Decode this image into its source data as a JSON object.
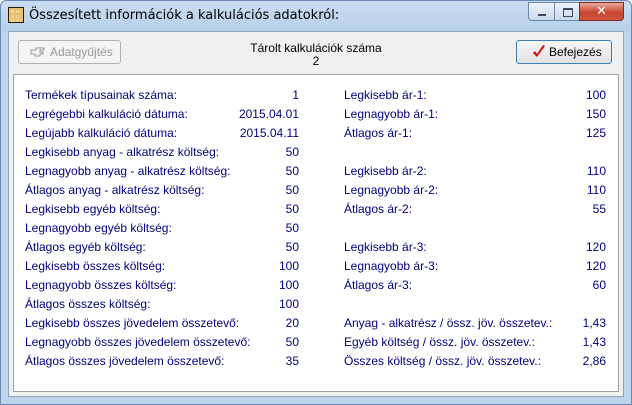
{
  "window": {
    "title": "Összesített információk a kalkulációs adatokról:",
    "close_label": "✕"
  },
  "toolbar": {
    "collect_label": "Adatgyűjtés",
    "finish_label": "Befejezés",
    "stored_title": "Tárolt kalkulációk száma",
    "stored_value": "2"
  },
  "left": [
    {
      "label": "Termékek típusainak száma:",
      "value": "1"
    },
    {
      "label": "Legrégebbi kalkuláció dátuma:",
      "value": "2015.04.01"
    },
    {
      "label": "Legújabb kalkuláció dátuma:",
      "value": "2015.04.11"
    },
    {
      "label": "Legkisebb anyag - alkatrész költség:",
      "value": "50"
    },
    {
      "label": "Legnagyobb anyag - alkatrész költség:",
      "value": "50"
    },
    {
      "label": "Átlagos anyag - alkatrész költség:",
      "value": "50"
    },
    {
      "label": "Legkisebb egyéb költség:",
      "value": "50"
    },
    {
      "label": "Legnagyobb egyéb költség:",
      "value": "50"
    },
    {
      "label": "Átlagos egyéb költség:",
      "value": "50"
    },
    {
      "label": "Legkisebb összes költség:",
      "value": "100"
    },
    {
      "label": "Legnagyobb összes költség:",
      "value": "100"
    },
    {
      "label": "Átlagos összes költség:",
      "value": "100"
    },
    {
      "label": "Legkisebb összes jövedelem összetevő:",
      "value": "20"
    },
    {
      "label": "Legnagyobb összes jövedelem összetevő:",
      "value": "50"
    },
    {
      "label": "Átlagos összes jövedelem összetevő:",
      "value": "35"
    }
  ],
  "right": [
    {
      "label": "Legkisebb ár-1:",
      "value": "100"
    },
    {
      "label": "Legnagyobb ár-1:",
      "value": "150"
    },
    {
      "label": "Átlagos ár-1:",
      "value": "125"
    },
    {
      "label": "Legkisebb ár-2:",
      "value": "110"
    },
    {
      "label": "Legnagyobb ár-2:",
      "value": "110"
    },
    {
      "label": "Átlagos ár-2:",
      "value": "55"
    },
    {
      "label": "Legkisebb ár-3:",
      "value": "120"
    },
    {
      "label": "Legnagyobb ár-3:",
      "value": "120"
    },
    {
      "label": "Átlagos ár-3:",
      "value": "60"
    },
    {
      "label": "Anyag - alkatrész / össz. jöv. összetev.:",
      "value": "1,43"
    },
    {
      "label": "Egyéb költség / össz. jöv. összetev.:",
      "value": "1,43"
    },
    {
      "label": "Összes költség / össz. jöv. összetev.:",
      "value": "2,86"
    }
  ],
  "icons": {
    "app": "calculator-grid-icon",
    "collect": "hand-pointing-icon",
    "finish": "red-check-icon"
  },
  "colors": {
    "label_text": "#000080",
    "check": "#d01010"
  }
}
